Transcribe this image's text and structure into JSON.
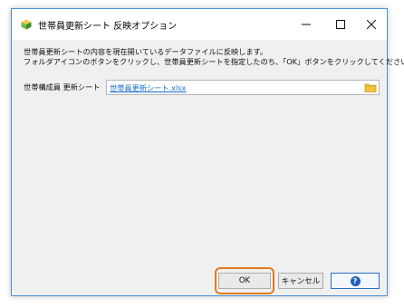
{
  "window": {
    "title": "世帯員更新シート 反映オプション",
    "controls": {
      "minimize": "—",
      "maximize": "☐",
      "close": "✕"
    }
  },
  "description": {
    "line1": "世帯員更新シートの内容を現在開いているデータファイルに反映します。",
    "line2": "フォルダアイコンのボタンをクリックし、世帯員更新シートを指定したのち、「OK」ボタンをクリックしてください。"
  },
  "field": {
    "label": "世帯構成員 更新シート",
    "file_name": "世帯員更新シート.xlsx"
  },
  "buttons": {
    "ok": "OK",
    "cancel": "キャンセル",
    "help": "?"
  },
  "colors": {
    "highlight": "#e27a1b",
    "link": "#1a6fd0",
    "help_border": "#2a6fc9",
    "window_border": "#4a90d9"
  }
}
